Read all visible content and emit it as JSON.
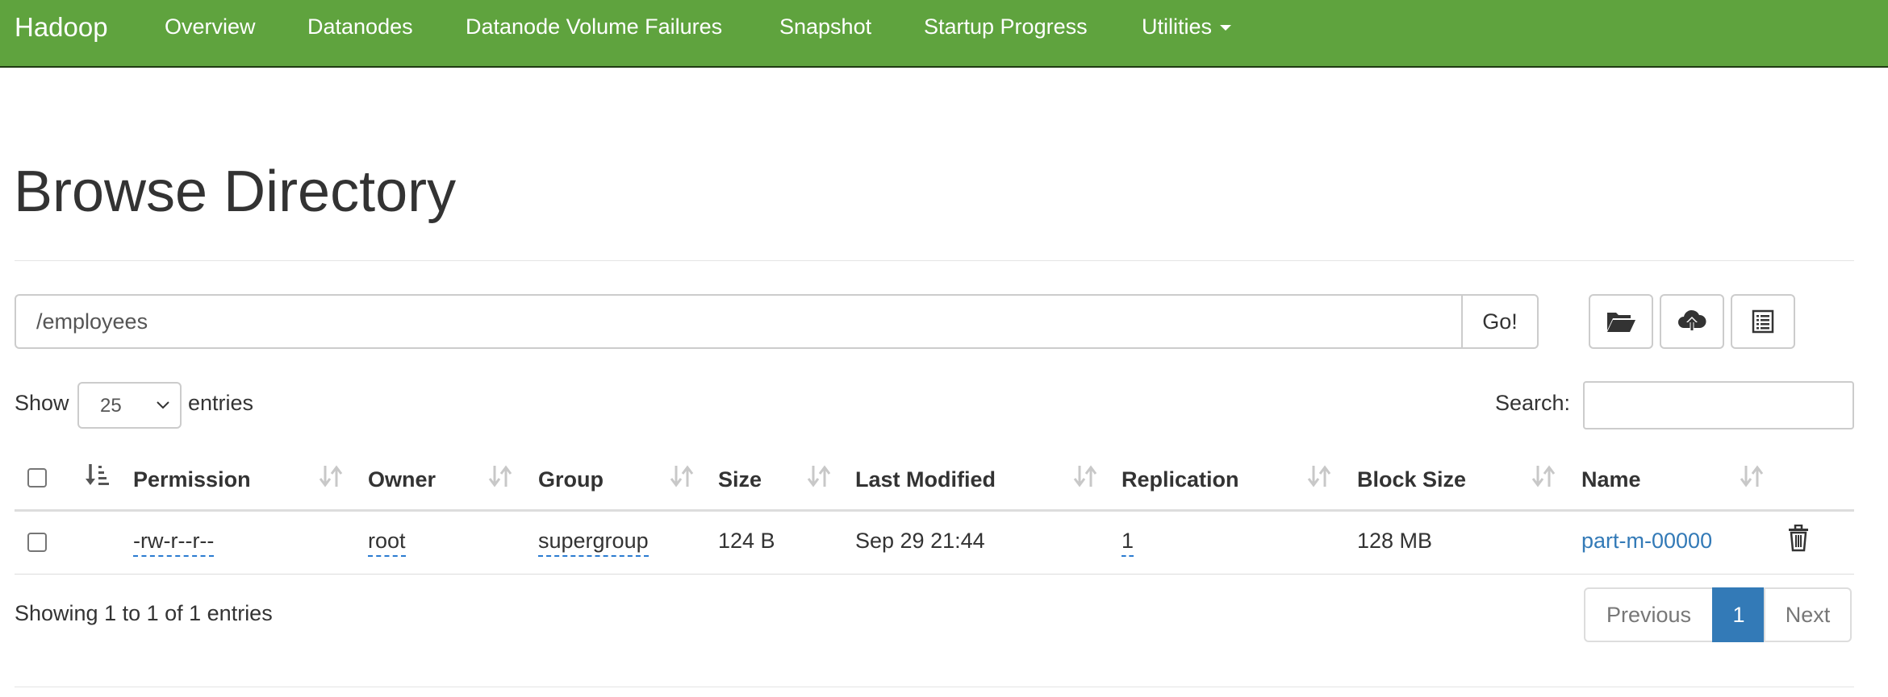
{
  "navbar": {
    "brand": "Hadoop",
    "items": [
      "Overview",
      "Datanodes",
      "Datanode Volume Failures",
      "Snapshot",
      "Startup Progress",
      "Utilities"
    ],
    "color": "#5fa33e"
  },
  "page": {
    "title": "Browse Directory"
  },
  "path_bar": {
    "value": "/employees",
    "go_label": "Go!"
  },
  "toolbar_icons": [
    "folder-open-icon",
    "cloud-upload-icon",
    "list-icon"
  ],
  "length_menu": {
    "prefix": "Show",
    "value": "25",
    "suffix": "entries"
  },
  "search": {
    "label": "Search:",
    "value": ""
  },
  "table": {
    "columns": [
      "Permission",
      "Owner",
      "Group",
      "Size",
      "Last Modified",
      "Replication",
      "Block Size",
      "Name"
    ],
    "rows": [
      {
        "permission": "-rw-r--r--",
        "owner": "root",
        "group": "supergroup",
        "size": "124 B",
        "last_modified": "Sep 29 21:44",
        "replication": "1",
        "block_size": "128 MB",
        "name": "part-m-00000"
      }
    ]
  },
  "footer": {
    "info": "Showing 1 to 1 of 1 entries",
    "pagination": {
      "previous": "Previous",
      "current": "1",
      "next": "Next"
    }
  },
  "colors": {
    "link": "#337ab7",
    "active_page": "#337ab7"
  }
}
